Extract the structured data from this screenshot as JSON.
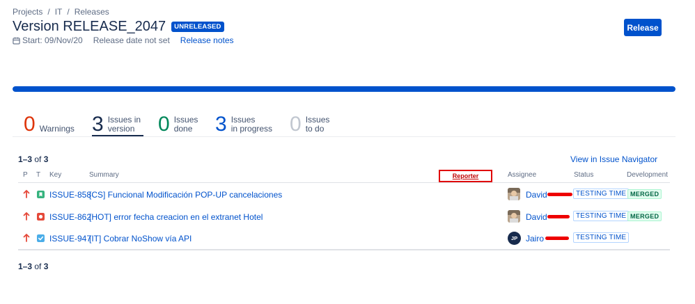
{
  "breadcrumb": [
    "Projects",
    "IT",
    "Releases"
  ],
  "breadcrumb_sep": "/",
  "title": "Version RELEASE_2047",
  "badge": "UNRELEASED",
  "start": "Start: 09/Nov/20",
  "release_date": "Release date not set",
  "release_notes": "Release notes",
  "release_button": "Release",
  "progress_fraction": 1.0,
  "summary_tabs": [
    {
      "num": "0",
      "label": "Warnings",
      "color": "#de350b"
    },
    {
      "num": "3",
      "label": "Issues in\nversion",
      "color": "#172b4d",
      "active": true
    },
    {
      "num": "0",
      "label": "Issues\ndone",
      "color": "#00875a"
    },
    {
      "num": "3",
      "label": "Issues\nin progress",
      "color": "#0052cc"
    },
    {
      "num": "0",
      "label": "Issues\nto do",
      "color": "#c1c7d0"
    }
  ],
  "count": {
    "range": "1–3",
    "of": "of",
    "total": "3"
  },
  "view_in_navigator": "View in Issue Navigator",
  "columns": {
    "p": "P",
    "t": "T",
    "key": "Key",
    "summary": "Summary",
    "reporter": "Reporter",
    "assignee": "Assignee",
    "status": "Status",
    "development": "Development"
  },
  "issues": [
    {
      "key": "ISSUE-858",
      "summary": "[CS] Funcional Modificación POP-UP cancelaciones",
      "type": "story",
      "assignee": "David",
      "status": "TESTING TIME",
      "development": "MERGED"
    },
    {
      "key": "ISSUE-862",
      "summary": "[HOT] error fecha creacion en el extranet Hotel",
      "type": "bug",
      "assignee": "David",
      "status": "TESTING TIME",
      "development": "MERGED"
    },
    {
      "key": "ISSUE-947",
      "summary": "[IT] Cobrar NoShow vía API",
      "type": "task",
      "assignee": "Jairo",
      "avatar_initials": "JP",
      "status": "TESTING TIME",
      "development": ""
    }
  ]
}
